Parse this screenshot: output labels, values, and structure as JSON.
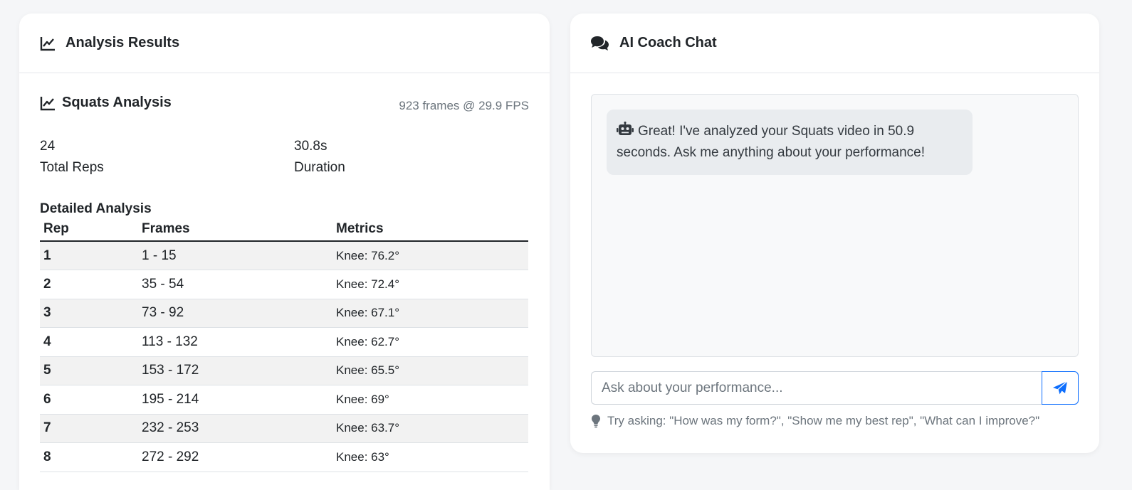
{
  "analysis": {
    "header_title": "Analysis Results",
    "section_title": "Squats Analysis",
    "meta": "923 frames @ 29.9 FPS",
    "stats": [
      {
        "value": "24",
        "label": "Total Reps"
      },
      {
        "value": "30.8s",
        "label": "Duration"
      }
    ],
    "detail_title": "Detailed Analysis",
    "table": {
      "headers": [
        "Rep",
        "Frames",
        "Metrics"
      ],
      "rows": [
        {
          "rep": "1",
          "frames": "1 - 15",
          "metrics": "Knee: 76.2°"
        },
        {
          "rep": "2",
          "frames": "35 - 54",
          "metrics": "Knee: 72.4°"
        },
        {
          "rep": "3",
          "frames": "73 - 92",
          "metrics": "Knee: 67.1°"
        },
        {
          "rep": "4",
          "frames": "113 - 132",
          "metrics": "Knee: 62.7°"
        },
        {
          "rep": "5",
          "frames": "153 - 172",
          "metrics": "Knee: 65.5°"
        },
        {
          "rep": "6",
          "frames": "195 - 214",
          "metrics": "Knee: 69°"
        },
        {
          "rep": "7",
          "frames": "232 - 253",
          "metrics": "Knee: 63.7°"
        },
        {
          "rep": "8",
          "frames": "272 - 292",
          "metrics": "Knee: 63°"
        }
      ]
    }
  },
  "chat": {
    "header_title": "AI Coach Chat",
    "messages": [
      {
        "sender": "bot",
        "icon": "robot-icon",
        "text": "Great! I've analyzed your Squats video in 50.9 seconds. Ask me anything about your performance!"
      }
    ],
    "input_placeholder": "Ask about your performance...",
    "input_value": "",
    "send_icon": "paper-plane-icon",
    "hint": "Try asking: \"How was my form?\", \"Show me my best rep\", \"What can I improve?\""
  },
  "colors": {
    "accent": "#0d6efd",
    "page_bg": "#f5f6f8",
    "stripe": "#f2f2f2",
    "muted": "#6c757d"
  }
}
